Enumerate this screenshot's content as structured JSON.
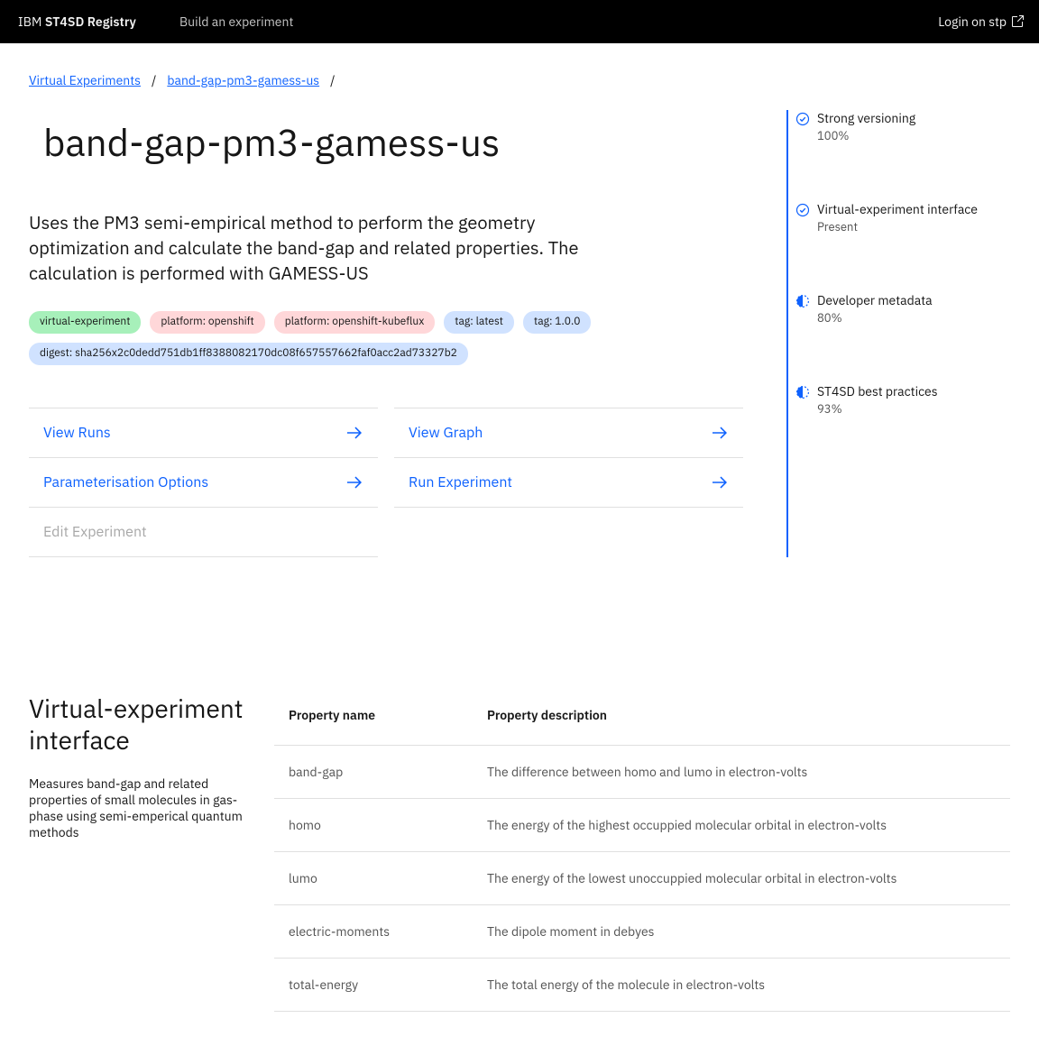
{
  "header": {
    "brand_prefix": "IBM ",
    "brand_strong": "ST4SD Registry",
    "nav_build": "Build an experiment",
    "login": "Login on stp"
  },
  "breadcrumb": {
    "root": "Virtual Experiments",
    "current": "band-gap-pm3-gamess-us"
  },
  "title": "band-gap-pm3-gamess-us",
  "description": "Uses the PM3 semi-empirical method to perform the geometry optimization and calculate the band-gap and related properties. The calculation is performed with GAMESS-US",
  "tags": [
    {
      "text": "virtual-experiment",
      "cls": "tag-green"
    },
    {
      "text": "platform: openshift",
      "cls": "tag-red"
    },
    {
      "text": "platform: openshift-kubeflux",
      "cls": "tag-red"
    },
    {
      "text": "tag: latest",
      "cls": "tag-blue"
    },
    {
      "text": "tag: 1.0.0",
      "cls": "tag-blue"
    },
    {
      "text": "digest: sha256x2c0dedd751db1ff8388082170dc08f657557662faf0acc2ad73327b2",
      "cls": "tag-blue"
    }
  ],
  "actions": {
    "view_runs": "View Runs",
    "view_graph": "View Graph",
    "param_options": "Parameterisation Options",
    "run_exp": "Run Experiment",
    "edit_exp": "Edit Experiment"
  },
  "side": [
    {
      "icon": "check",
      "label": "Strong versioning",
      "value": "100%"
    },
    {
      "icon": "check",
      "label": "Virtual-experiment interface",
      "value": "Present"
    },
    {
      "icon": "half",
      "label": "Developer metadata",
      "value": "80%"
    },
    {
      "icon": "half",
      "label": "ST4SD best practices",
      "value": "93%"
    }
  ],
  "interface": {
    "heading": "Virtual-experiment interface",
    "subtext": "Measures band-gap and related properties of small molecules in gas-phase using semi-emperical quantum methods",
    "columns": {
      "name": "Property name",
      "desc": "Property description"
    },
    "rows": [
      {
        "name": "band-gap",
        "desc": "The difference between homo and lumo in electron-volts"
      },
      {
        "name": "homo",
        "desc": "The energy of the highest occuppied molecular orbital in electron-volts"
      },
      {
        "name": "lumo",
        "desc": "The energy of the lowest unoccuppied molecular orbital in electron-volts"
      },
      {
        "name": "electric-moments",
        "desc": "The dipole moment in debyes"
      },
      {
        "name": "total-energy",
        "desc": "The total energy of the molecule in electron-volts"
      }
    ]
  }
}
